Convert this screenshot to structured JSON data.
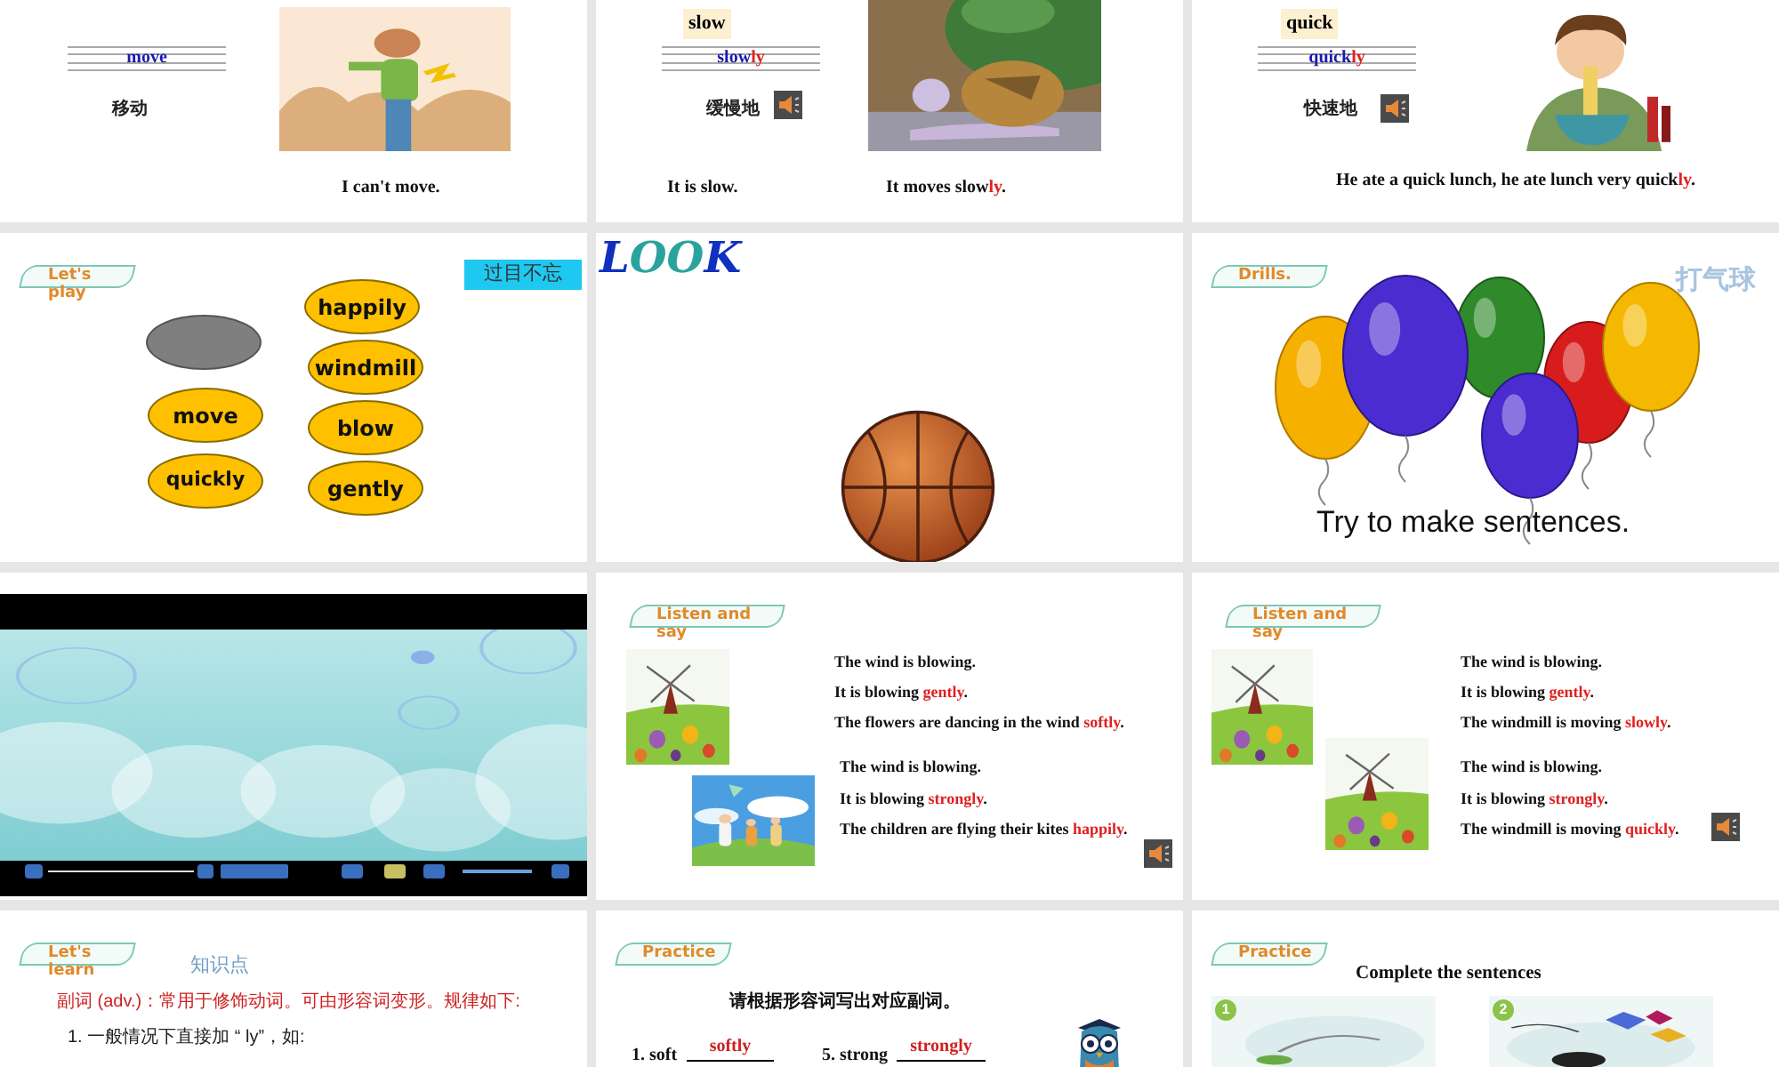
{
  "slides": [
    {
      "kind": "word",
      "word": [
        {
          "text": "move",
          "highlight": false
        }
      ],
      "meaning": "移动",
      "speaker": false,
      "sentences": [
        [
          {
            "text": "I can't move.",
            "highlight": false
          }
        ]
      ]
    },
    {
      "kind": "word",
      "tag": "slow",
      "word": [
        {
          "text": "slow",
          "highlight": false
        },
        {
          "text": "ly",
          "highlight": true
        }
      ],
      "meaning": "缓慢地",
      "speaker": true,
      "sentences": [
        [
          {
            "text": "It is slow.",
            "highlight": false
          }
        ],
        [
          {
            "text": "It moves slow",
            "highlight": false
          },
          {
            "text": "ly",
            "highlight": true
          },
          {
            "text": ".",
            "highlight": false
          }
        ]
      ]
    },
    {
      "kind": "word",
      "tag": "quick",
      "word": [
        {
          "text": "quick",
          "highlight": false
        },
        {
          "text": "ly",
          "highlight": true
        }
      ],
      "meaning": "快速地",
      "speaker": true,
      "sentences": [
        [
          {
            "text": "He ate a quick lunch, he ate lunch very quick",
            "highlight": false
          },
          {
            "text": "ly",
            "highlight": true
          },
          {
            "text": ".",
            "highlight": false
          }
        ]
      ]
    },
    {
      "kind": "game",
      "banner": "Let's play",
      "badge": "过目不忘",
      "ovals": [
        {
          "kind": "blank"
        },
        {
          "kind": "word",
          "text": "move"
        },
        {
          "kind": "word",
          "text": "quickly"
        },
        {
          "kind": "word",
          "text": "happily"
        },
        {
          "kind": "word",
          "text": "windmill"
        },
        {
          "kind": "word",
          "text": "blow"
        },
        {
          "kind": "word",
          "text": "gently"
        }
      ]
    },
    {
      "kind": "look",
      "logo": "LOOK"
    },
    {
      "kind": "drills",
      "banner": "Drills.",
      "hint": "打气球",
      "prompt": "Try to make sentences."
    },
    {
      "kind": "video"
    },
    {
      "kind": "listen",
      "banner": "Listen and say",
      "speaker": true,
      "groups": [
        {
          "lines": [
            [
              {
                "text": "The wind is blowing.",
                "highlight": false
              }
            ],
            [
              {
                "text": "It is blowing ",
                "highlight": false
              },
              {
                "text": "gently",
                "highlight": true
              },
              {
                "text": ".",
                "highlight": false
              }
            ],
            [
              {
                "text": "The flowers are dancing in the wind ",
                "highlight": false
              },
              {
                "text": "softly",
                "highlight": true
              },
              {
                "text": ".",
                "highlight": false
              }
            ]
          ]
        },
        {
          "lines": [
            [
              {
                "text": "The wind is blowing.",
                "highlight": false
              }
            ],
            [
              {
                "text": "It is blowing ",
                "highlight": false
              },
              {
                "text": "strongly",
                "highlight": true
              },
              {
                "text": ".",
                "highlight": false
              }
            ],
            [
              {
                "text": "The children are flying their kites ",
                "highlight": false
              },
              {
                "text": "happily",
                "highlight": true
              },
              {
                "text": ".",
                "highlight": false
              }
            ]
          ]
        }
      ]
    },
    {
      "kind": "listen",
      "banner": "Listen and say",
      "speaker": true,
      "groups": [
        {
          "lines": [
            [
              {
                "text": "The wind is blowing.",
                "highlight": false
              }
            ],
            [
              {
                "text": "It is blowing ",
                "highlight": false
              },
              {
                "text": "gently",
                "highlight": true
              },
              {
                "text": ".",
                "highlight": false
              }
            ],
            [
              {
                "text": "The windmill is moving ",
                "highlight": false
              },
              {
                "text": "slowly",
                "highlight": true
              },
              {
                "text": ".",
                "highlight": false
              }
            ]
          ]
        },
        {
          "lines": [
            [
              {
                "text": "The wind is blowing.",
                "highlight": false
              }
            ],
            [
              {
                "text": "It is blowing ",
                "highlight": false
              },
              {
                "text": "strongly",
                "highlight": true
              },
              {
                "text": ".",
                "highlight": false
              }
            ],
            [
              {
                "text": "The windmill is moving ",
                "highlight": false
              },
              {
                "text": "quickly",
                "highlight": true
              },
              {
                "text": ".",
                "highlight": false
              }
            ]
          ]
        }
      ]
    },
    {
      "kind": "learn",
      "banner": "Let's learn",
      "topic": "知识点",
      "rule": "副词 (adv.)：常用于修饰动词。可由形容词变形。规律如下:",
      "point": "1. 一般情况下直接加 “ ly”，如:"
    },
    {
      "kind": "fill",
      "banner": "Practice",
      "instruction": "请根据形容词写出对应副词。",
      "items": [
        {
          "label": "1. soft",
          "answer": "softly"
        },
        {
          "label": "5. strong",
          "answer": "strongly"
        }
      ]
    },
    {
      "kind": "pictures",
      "banner": "Practice",
      "title": "Complete the sentences",
      "pictures": [
        {
          "number": "1"
        },
        {
          "number": "2"
        }
      ]
    }
  ]
}
